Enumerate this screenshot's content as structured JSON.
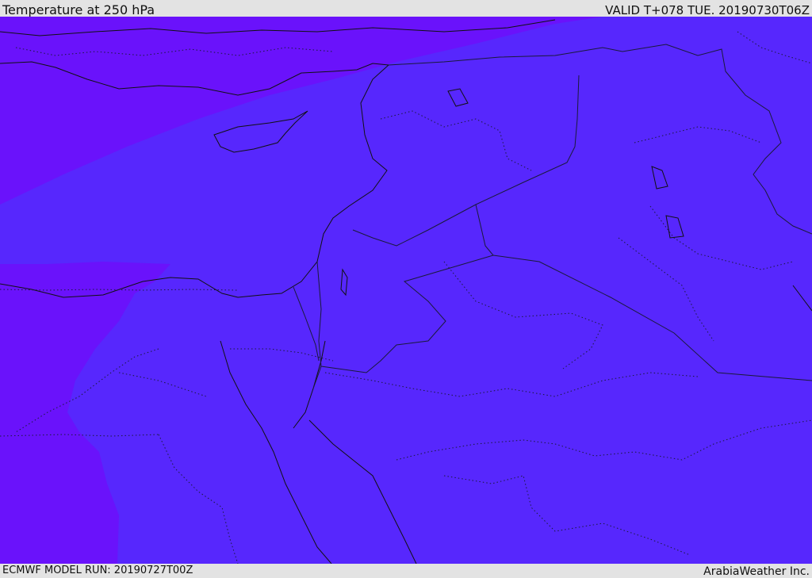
{
  "header": {
    "title": "Temperature at 250 hPa",
    "valid": "VALID T+078 TUE. 20190730T06Z"
  },
  "footer": {
    "model_run": "ECMWF MODEL RUN: 20190727T00Z",
    "credit": "ArabiaWeather Inc."
  },
  "map": {
    "colors": {
      "cold_band": "#6a12fb",
      "main_fill": "#5727fd",
      "coastline": "#111111",
      "border_line": "#1a1a3a"
    }
  }
}
